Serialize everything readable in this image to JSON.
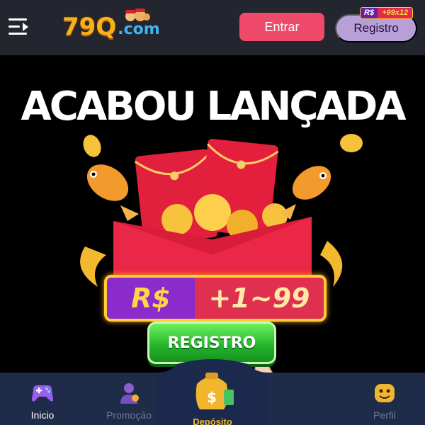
{
  "header": {
    "logo_number": "79Q",
    "logo_domain": ".com",
    "login_label": "Entrar",
    "register_label": "Registro",
    "register_badge": {
      "currency": "R$",
      "amount": "+99x12"
    }
  },
  "promo": {
    "headline": "ACABOU LANÇADA",
    "bonus_currency": "R$",
    "bonus_range": "+1~99",
    "cta_label": "REGISTRO"
  },
  "bottom_nav": {
    "items": [
      {
        "label": "Inicio",
        "icon": "gamepad-icon",
        "active": true
      },
      {
        "label": "Promoção",
        "icon": "promo-person-icon",
        "active": false
      },
      {
        "label": "Depósito",
        "icon": "money-bag-icon",
        "active": false
      },
      {
        "label": "Perfil",
        "icon": "smiley-icon",
        "active": false
      }
    ]
  },
  "colors": {
    "header_bg": "#23262e",
    "login_button": "#ef4a6a",
    "register_button": "#b79fd7",
    "nav_bg": "#1e2c4a",
    "cta_green": "#23b22c",
    "envelope_red": "#e0203c",
    "gold": "#f5b21a"
  }
}
